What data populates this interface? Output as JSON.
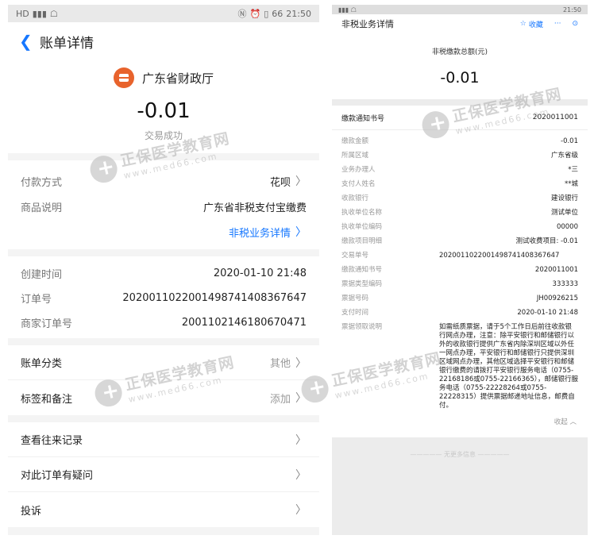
{
  "left": {
    "status_time": "21:50",
    "status_battery": "66",
    "header_title": "账单详情",
    "merchant": "广东省财政厅",
    "amount": "-0.01",
    "amount_status": "交易成功",
    "pay_method_label": "付款方式",
    "pay_method_value": "花呗",
    "goods_label": "商品说明",
    "goods_value": "广东省非税支付宝缴费",
    "detail_link": "非税业务详情",
    "created_label": "创建时间",
    "created_value": "2020-01-10 21:48",
    "order_no_label": "订单号",
    "order_no_value": "2020011022001498741408367647",
    "merchant_order_label": "商家订单号",
    "merchant_order_value": "2001102146180670471",
    "category_label": "账单分类",
    "category_value": "其他",
    "tags_label": "标签和备注",
    "tags_value": "添加",
    "history_label": "查看往来记录",
    "question_label": "对此订单有疑问",
    "complaint_label": "投诉"
  },
  "right": {
    "status_time": "21:50",
    "header_title": "非税业务详情",
    "fav_label": "收藏",
    "more_label": "···",
    "total_caption": "非税缴款总额(元)",
    "total_amount": "-0.01",
    "notice_label": "缴款通知书号",
    "notice_value": "2020011001",
    "rows": [
      {
        "k": "缴款金额",
        "v": "-0.01"
      },
      {
        "k": "所属区域",
        "v": "广东省级"
      },
      {
        "k": "业务办理人",
        "v": "*三"
      },
      {
        "k": "支付人姓名",
        "v": "**城"
      },
      {
        "k": "收款银行",
        "v": "建设银行"
      },
      {
        "k": "执收单位名称",
        "v": "测试单位"
      },
      {
        "k": "执收单位编码",
        "v": "00000"
      },
      {
        "k": "缴款项目明细",
        "v": "测试收费项目: -0.01"
      }
    ],
    "trade_no_label": "交易单号",
    "trade_no_value": "2020011022001498741408367647",
    "rows2": [
      {
        "k": "缴款通知书号",
        "v": "2020011001"
      },
      {
        "k": "票据类型编码",
        "v": "333333"
      },
      {
        "k": "票据号码",
        "v": "JH00926215"
      },
      {
        "k": "支付时间",
        "v": "2020-01-10 21:48"
      }
    ],
    "receipt_label": "票据领取说明",
    "receipt_value": "如需纸质票据，请于5个工作日后前往收款银行网点办理，注意：除平安银行和邮储银行以外的收款银行提供广东省内除深圳区域以外任一网点办理，平安银行和邮储银行只提供深圳区域网点办理，其他区域选择平安银行和邮储银行缴费的请拨打平安银行服务电话（0755-22168186或0755-22166365），邮储银行服务电话（0755-22228264或0755-22228315）提供票据邮递地址信息，邮费自付。",
    "collapse_label": "收起 ︿",
    "bottom_text": "—————   无更多信息   —————"
  },
  "watermark": {
    "text": "正保医学教育网",
    "url": "www.med66.com"
  }
}
